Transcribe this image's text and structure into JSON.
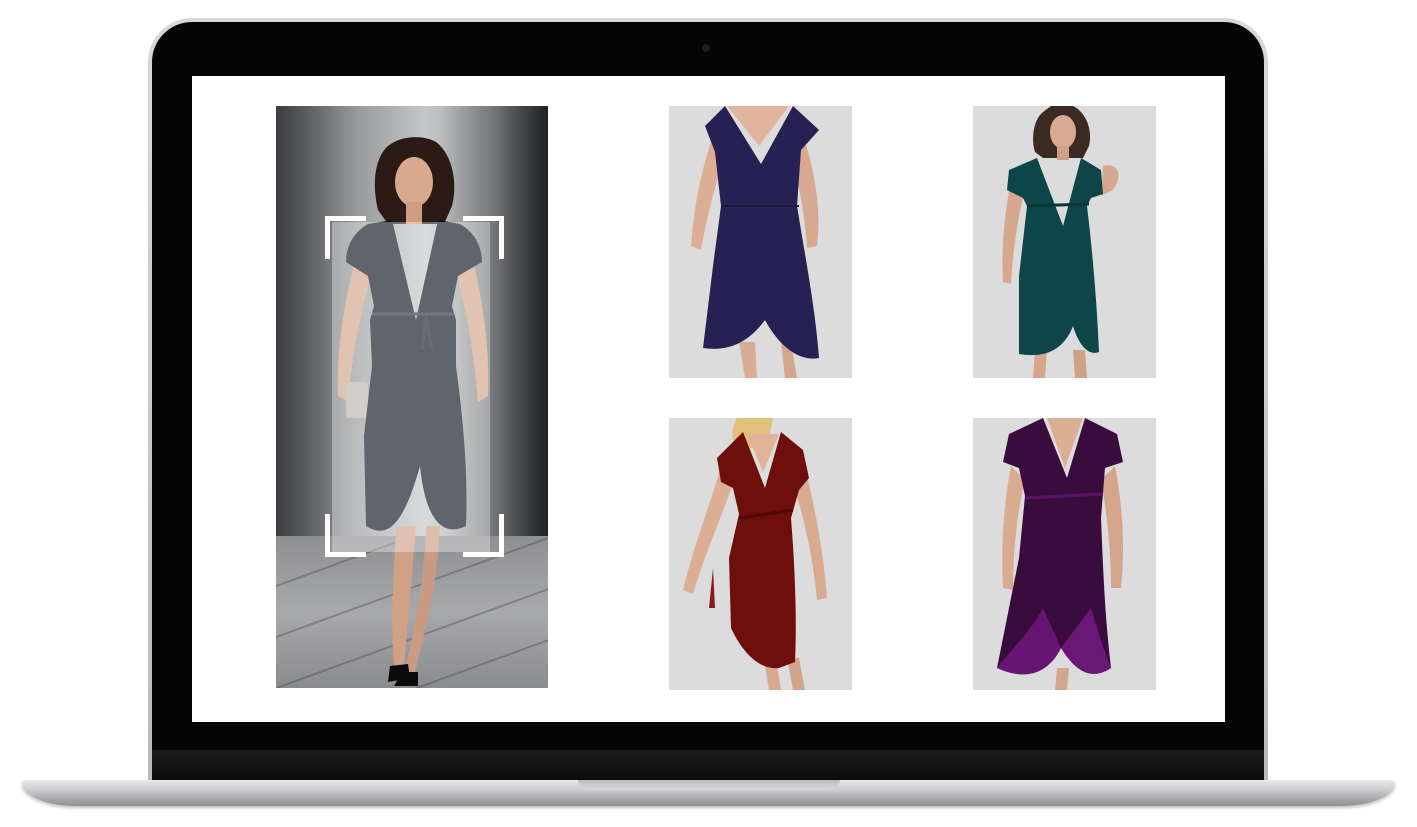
{
  "device": {
    "frame_color": "#c4c4c4",
    "bezel_color": "#050505",
    "screen_color": "#ffffff"
  },
  "query": {
    "dress_color": "#0c1120",
    "scan_overlay_color": "#ffffff",
    "icon": "scan-frame-icon"
  },
  "results": [
    {
      "dress_color": "#262152",
      "background": "#dcdcdc"
    },
    {
      "dress_color": "#0e4548",
      "background": "#dcdcdc"
    },
    {
      "dress_color": "#6e0f0c",
      "background": "#dcdcdc"
    },
    {
      "dress_color": "#3a0c3e",
      "background": "#dcdcdc"
    }
  ]
}
